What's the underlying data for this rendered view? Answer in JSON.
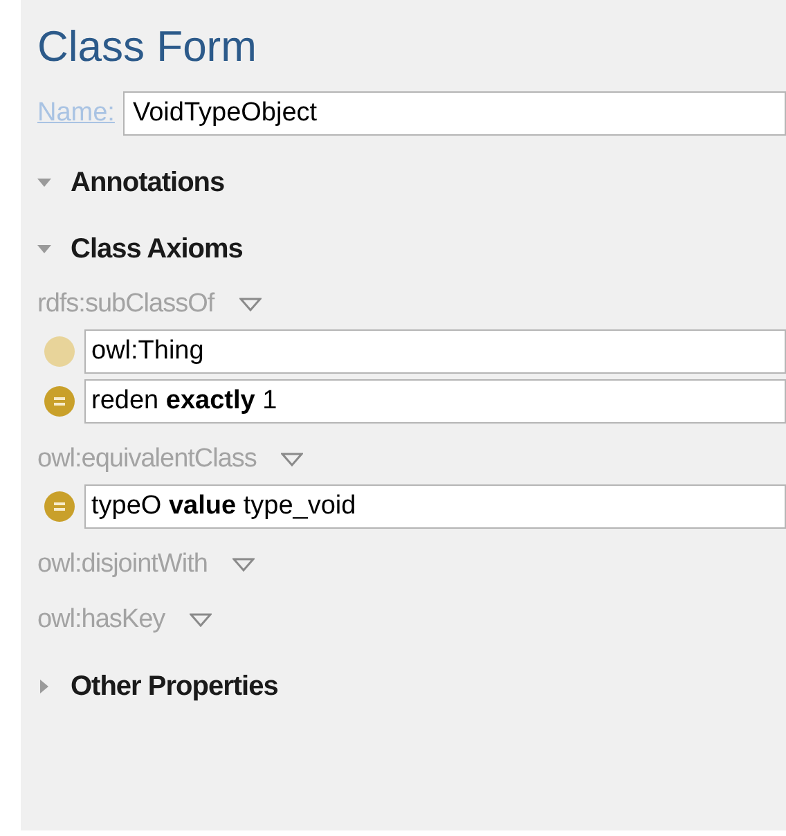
{
  "title": "Class Form",
  "name_field": {
    "label": "Name:",
    "value": "VoidTypeObject"
  },
  "sections": [
    {
      "label": "Annotations",
      "expanded": true
    },
    {
      "label": "Class Axioms",
      "expanded": true,
      "groups": [
        {
          "label": "rdfs:subClassOf",
          "entries": [
            {
              "kind": "class",
              "text": "owl:Thing"
            },
            {
              "kind": "restriction",
              "text": "reden **exactly** 1"
            }
          ]
        },
        {
          "label": "owl:equivalentClass",
          "entries": [
            {
              "kind": "restriction",
              "text": "typeO **value** type_void"
            }
          ]
        },
        {
          "label": "owl:disjointWith"
        },
        {
          "label": "owl:hasKey"
        }
      ]
    },
    {
      "label": "Other Properties",
      "expanded": false
    }
  ]
}
